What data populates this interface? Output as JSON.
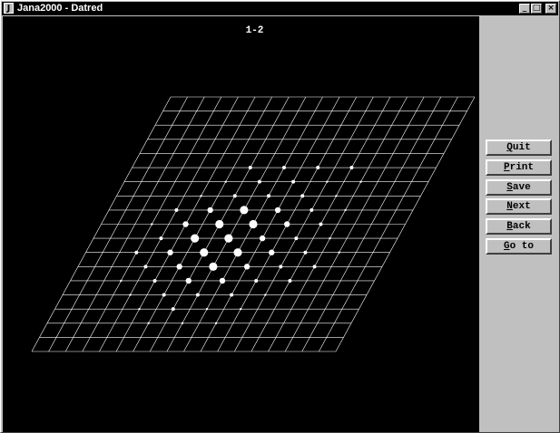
{
  "window": {
    "title": "Jana2000 - Datred",
    "app_icon_letter": "J",
    "controls": {
      "minimize": "_",
      "maximize": "□",
      "close": "×"
    }
  },
  "plot": {
    "caption": "1-2",
    "background": "#000000",
    "foreground": "#ffffff",
    "grid": {
      "rows": 18,
      "cols": 18
    },
    "reflections": [
      {
        "col": 9,
        "row": 5,
        "size": "small"
      },
      {
        "col": 11,
        "row": 5,
        "size": "small"
      },
      {
        "col": 13,
        "row": 5,
        "size": "small"
      },
      {
        "col": 7,
        "row": 5,
        "size": "small"
      },
      {
        "col": 6,
        "row": 6,
        "size": "tiny"
      },
      {
        "col": 8,
        "row": 6,
        "size": "small"
      },
      {
        "col": 10,
        "row": 6,
        "size": "small"
      },
      {
        "col": 12,
        "row": 6,
        "size": "tiny"
      },
      {
        "col": 14,
        "row": 6,
        "size": "tiny"
      },
      {
        "col": 5,
        "row": 7,
        "size": "tiny"
      },
      {
        "col": 7,
        "row": 7,
        "size": "small"
      },
      {
        "col": 9,
        "row": 7,
        "size": "small"
      },
      {
        "col": 11,
        "row": 7,
        "size": "small"
      },
      {
        "col": 13,
        "row": 7,
        "size": "tiny"
      },
      {
        "col": 4,
        "row": 8,
        "size": "small"
      },
      {
        "col": 6,
        "row": 8,
        "size": "medium"
      },
      {
        "col": 8,
        "row": 8,
        "size": "large"
      },
      {
        "col": 10,
        "row": 8,
        "size": "medium"
      },
      {
        "col": 12,
        "row": 8,
        "size": "small"
      },
      {
        "col": 14,
        "row": 8,
        "size": "tiny"
      },
      {
        "col": 3,
        "row": 9,
        "size": "tiny"
      },
      {
        "col": 5,
        "row": 9,
        "size": "medium"
      },
      {
        "col": 7,
        "row": 9,
        "size": "large"
      },
      {
        "col": 9,
        "row": 9,
        "size": "large"
      },
      {
        "col": 11,
        "row": 9,
        "size": "medium"
      },
      {
        "col": 13,
        "row": 9,
        "size": "small"
      },
      {
        "col": 4,
        "row": 10,
        "size": "small"
      },
      {
        "col": 6,
        "row": 10,
        "size": "large"
      },
      {
        "col": 8,
        "row": 10,
        "size": "large"
      },
      {
        "col": 10,
        "row": 10,
        "size": "medium"
      },
      {
        "col": 12,
        "row": 10,
        "size": "small"
      },
      {
        "col": 14,
        "row": 10,
        "size": "tiny"
      },
      {
        "col": 3,
        "row": 11,
        "size": "small"
      },
      {
        "col": 5,
        "row": 11,
        "size": "medium"
      },
      {
        "col": 7,
        "row": 11,
        "size": "large"
      },
      {
        "col": 9,
        "row": 11,
        "size": "large"
      },
      {
        "col": 11,
        "row": 11,
        "size": "medium"
      },
      {
        "col": 13,
        "row": 11,
        "size": "small"
      },
      {
        "col": 15,
        "row": 11,
        "size": "tiny"
      },
      {
        "col": 4,
        "row": 12,
        "size": "small"
      },
      {
        "col": 6,
        "row": 12,
        "size": "medium"
      },
      {
        "col": 8,
        "row": 12,
        "size": "large"
      },
      {
        "col": 10,
        "row": 12,
        "size": "medium"
      },
      {
        "col": 12,
        "row": 12,
        "size": "small"
      },
      {
        "col": 14,
        "row": 12,
        "size": "small"
      },
      {
        "col": 3,
        "row": 13,
        "size": "tiny"
      },
      {
        "col": 5,
        "row": 13,
        "size": "small"
      },
      {
        "col": 7,
        "row": 13,
        "size": "medium"
      },
      {
        "col": 9,
        "row": 13,
        "size": "medium"
      },
      {
        "col": 11,
        "row": 13,
        "size": "small"
      },
      {
        "col": 13,
        "row": 13,
        "size": "small"
      },
      {
        "col": 4,
        "row": 14,
        "size": "tiny"
      },
      {
        "col": 6,
        "row": 14,
        "size": "small"
      },
      {
        "col": 8,
        "row": 14,
        "size": "small"
      },
      {
        "col": 10,
        "row": 14,
        "size": "small"
      },
      {
        "col": 12,
        "row": 14,
        "size": "tiny"
      },
      {
        "col": 5,
        "row": 15,
        "size": "tiny"
      },
      {
        "col": 7,
        "row": 15,
        "size": "small"
      },
      {
        "col": 9,
        "row": 15,
        "size": "tiny"
      },
      {
        "col": 11,
        "row": 15,
        "size": "tiny"
      },
      {
        "col": 6,
        "row": 16,
        "size": "tiny"
      },
      {
        "col": 8,
        "row": 16,
        "size": "tiny"
      },
      {
        "col": 10,
        "row": 16,
        "size": "tiny"
      }
    ]
  },
  "buttons": [
    {
      "id": "quit",
      "label": "Quit",
      "hotkey": "Q",
      "rest": "uit"
    },
    {
      "id": "print",
      "label": "Print",
      "hotkey": "P",
      "rest": "rint"
    },
    {
      "id": "save",
      "label": "Save",
      "hotkey": "S",
      "rest": "ave"
    },
    {
      "id": "next",
      "label": "Next",
      "hotkey": "N",
      "rest": "ext"
    },
    {
      "id": "back",
      "label": "Back",
      "hotkey": "B",
      "rest": "ack"
    },
    {
      "id": "goto",
      "label": "Go to",
      "hotkey": "G",
      "rest": "o to"
    }
  ]
}
